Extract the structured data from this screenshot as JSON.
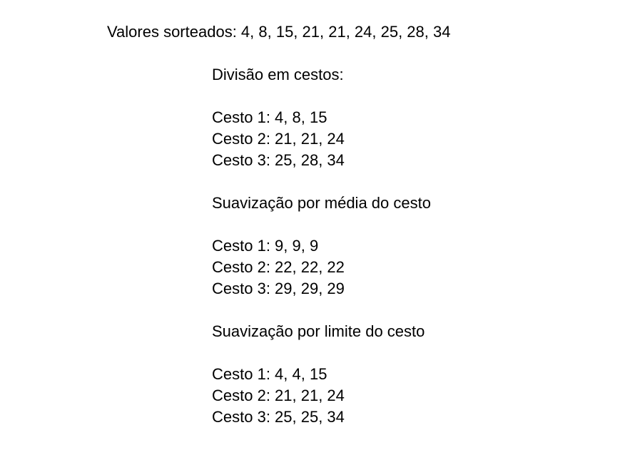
{
  "sorted_values": "Valores sorteados: 4, 8, 15, 21, 21, 24, 25, 28, 34",
  "division": {
    "title": "Divisão em cestos:",
    "bins": [
      "Cesto 1: 4, 8, 15",
      "Cesto 2: 21, 21, 24",
      "Cesto 3: 25, 28, 34"
    ]
  },
  "mean_smoothing": {
    "title": "Suavização por média do cesto",
    "bins": [
      "Cesto 1: 9, 9, 9",
      "Cesto 2: 22, 22, 22",
      "Cesto 3: 29, 29, 29"
    ]
  },
  "boundary_smoothing": {
    "title": "Suavização por limite do cesto",
    "bins": [
      "Cesto 1: 4, 4, 15",
      "Cesto 2: 21, 21, 24",
      "Cesto 3: 25, 25, 34"
    ]
  }
}
